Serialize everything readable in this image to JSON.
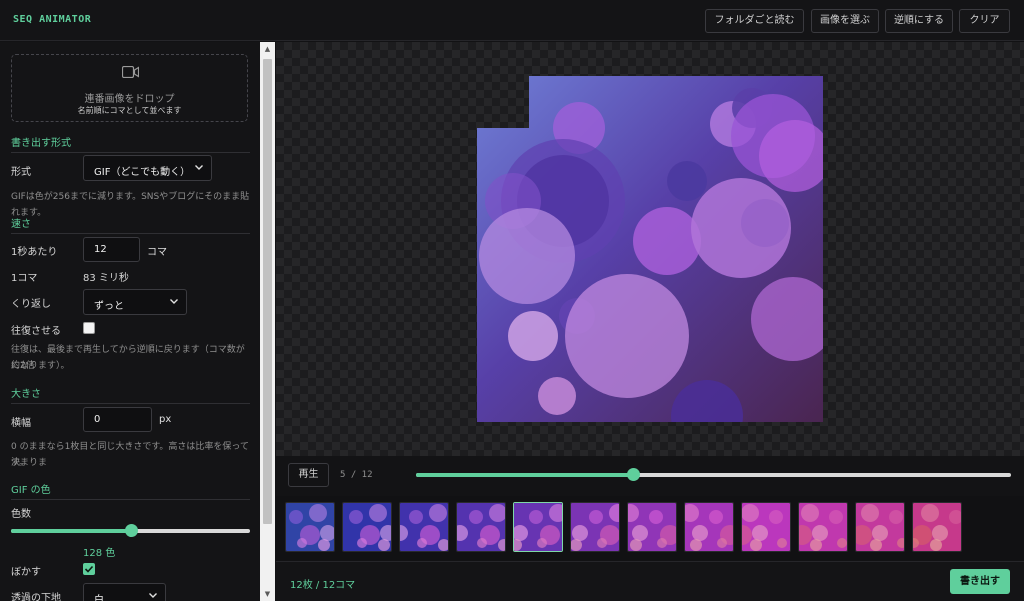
{
  "app": {
    "title": "SEQ ANIMATOR"
  },
  "toolbar": {
    "open_folder": "フォルダごと読む",
    "choose_images": "画像を選ぶ",
    "reverse": "逆順にする",
    "clear": "クリア"
  },
  "dropzone": {
    "title": "連番画像をドロップ",
    "subtitle": "名前順にコマとして並べます",
    "icon": "video-camera-icon"
  },
  "format": {
    "section": "書き出す形式",
    "label": "形式",
    "selected": "GIF（どこでも動く）",
    "help": "GIFは色が256までに減ります。SNSやブログにそのまま貼れます。"
  },
  "speed": {
    "section": "速さ",
    "fps_label": "1秒あたり",
    "fps_value": "12",
    "fps_unit": "コマ",
    "frame_label": "1コマ",
    "frame_value": "83 ミリ秒",
    "loop_label": "くり返し",
    "loop_selected": "ずっと",
    "pingpong_label": "往復させる",
    "pingpong_checked": false,
    "pingpong_help_1": "往復は、最後まで再生してから逆順に戻ります（コマ数が約2倍",
    "pingpong_help_2": "になります）。"
  },
  "size": {
    "section": "大きさ",
    "width_label": "横幅",
    "width_value": "0",
    "width_unit": "px",
    "help_1": "0 のままなら1枚目と同じ大きさです。高さは比率を保って決まりま",
    "help_2": "す。"
  },
  "gif_colors": {
    "section": "GIF の色",
    "colors_label": "色数",
    "colors_value": "128 色",
    "colors_fraction": 0.5,
    "dither_label": "ぼかす",
    "dither_checked": true,
    "bg_label": "透過の下地",
    "bg_selected": "白"
  },
  "player": {
    "play_label": "再生",
    "frame_counter": "5 / 12",
    "progress_fraction": 0.364
  },
  "frames": {
    "count": 12,
    "selected_index": 4
  },
  "footer": {
    "count_label": "12枚 / 12コマ",
    "export_label": "書き出す"
  },
  "colors": {
    "accent": "#5fcf9c",
    "background": "#121214"
  }
}
